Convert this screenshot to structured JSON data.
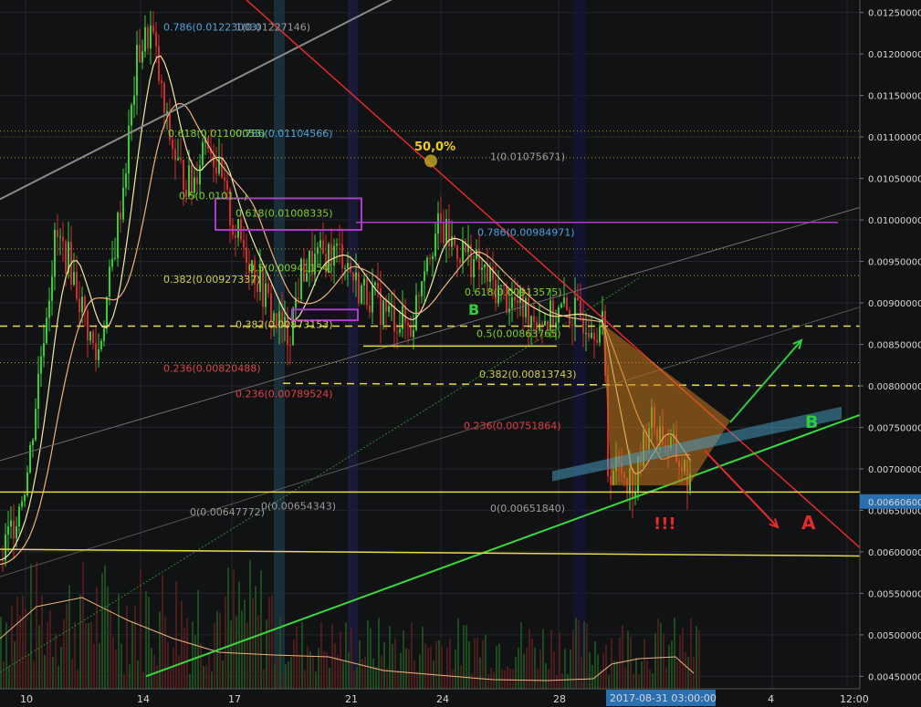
{
  "chart_data": {
    "type": "candlestick",
    "price_axis": {
      "ticks": [
        "0.01250000",
        "0.01200000",
        "0.01150000",
        "0.01100000",
        "0.01050000",
        "0.01000000",
        "0.00950000",
        "0.00900000",
        "0.00850000",
        "0.00800000",
        "0.00750000",
        "0.00700000",
        "0.00650000",
        "0.00600000",
        "0.00550000",
        "0.00500000",
        "0.00450000"
      ],
      "ylim": [
        0.00435,
        0.01265
      ],
      "current_price": "0.00660600",
      "current_price_color": "#2a6fb0"
    },
    "time_axis": {
      "ticks": [
        "10",
        "14",
        "17",
        "21",
        "24",
        "28",
        "4",
        "12:00"
      ],
      "crosshair_label": "2017-08-31 03:00:00"
    },
    "fib_labels": [
      {
        "text": "0.786(0.01223003)",
        "color": "#4aa3df"
      },
      {
        "text": "1(0.01227146)",
        "color": "#9a9a9a"
      },
      {
        "text": "0.786(0.01104566)",
        "color": "#4aa3df"
      },
      {
        "text": "0.618(0.01100053)",
        "color": "#7ed321"
      },
      {
        "text": "1(0.01075671)",
        "color": "#9a9a9a"
      },
      {
        "text": "0.5(0.0101...)",
        "color": "#7ed321"
      },
      {
        "text": "0.618(0.01008335)",
        "color": "#7ed321"
      },
      {
        "text": "0.786(0.00984971)",
        "color": "#4aa3df"
      },
      {
        "text": "0.382(0.00927337)",
        "color": "#d0d040"
      },
      {
        "text": "0.5(0.00941154)",
        "color": "#7ed321"
      },
      {
        "text": "0.618(0.00913575)",
        "color": "#7ed321"
      },
      {
        "text": "0.382(0.00873153)",
        "color": "#d0d040"
      },
      {
        "text": "0.5(0.00863765)",
        "color": "#7ed321"
      },
      {
        "text": "0.382(0.00813743)",
        "color": "#d0d040"
      },
      {
        "text": "0.236(0.00820488)",
        "color": "#e04040"
      },
      {
        "text": "0.236(0.00789524)",
        "color": "#e04040"
      },
      {
        "text": "0.236(0.00751864)",
        "color": "#e04040"
      },
      {
        "text": "0(0.00654343)",
        "color": "#9a9a9a"
      },
      {
        "text": "0(0.00647772)",
        "color": "#9a9a9a"
      },
      {
        "text": "0(0.00651840)",
        "color": "#9a9a9a"
      }
    ],
    "annotations": [
      {
        "text": "50,0%",
        "color": "#f0d000"
      },
      {
        "text": "B",
        "color": "#2ecc40"
      },
      {
        "text": "B",
        "color": "#2ecc40"
      },
      {
        "text": "A",
        "color": "#e52a2a"
      },
      {
        "text": "!!!",
        "color": "#e52a2a"
      }
    ],
    "colors": {
      "up": "#2fd12f",
      "down": "#d42a2a",
      "ma_fast": "#f5e9a0",
      "ma_slow": "#f0b27a",
      "background": "#111214"
    }
  }
}
